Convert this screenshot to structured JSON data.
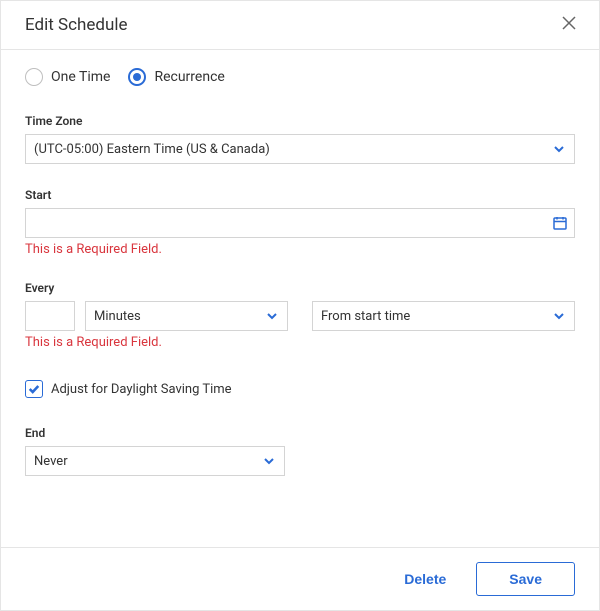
{
  "header": {
    "title": "Edit Schedule"
  },
  "scheduleType": {
    "oneTime": "One Time",
    "recurrence": "Recurrence",
    "selected": "recurrence"
  },
  "timeZone": {
    "label": "Time Zone",
    "value": "(UTC-05:00) Eastern Time (US & Canada)"
  },
  "start": {
    "label": "Start",
    "value": "",
    "error": "This is a Required Field."
  },
  "every": {
    "label": "Every",
    "amount": "",
    "unit": "Minutes",
    "fromOption": "From start time",
    "error": "This is a Required Field."
  },
  "dst": {
    "checked": true,
    "label": "Adjust for Daylight Saving Time"
  },
  "end": {
    "label": "End",
    "value": "Never"
  },
  "footer": {
    "delete": "Delete",
    "save": "Save"
  }
}
